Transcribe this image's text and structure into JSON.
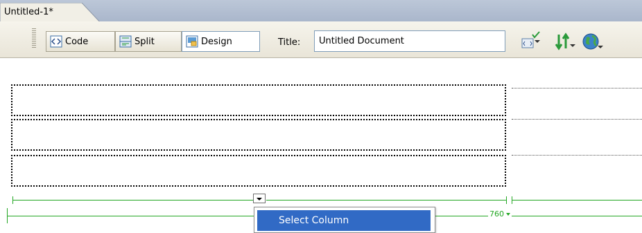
{
  "document": {
    "tab_title": "Untitled-1*"
  },
  "toolbar": {
    "code_label": "Code",
    "split_label": "Split",
    "design_label": "Design",
    "active_view": "Design",
    "title_label": "Title:",
    "title_value": "Untitled Document",
    "icons": [
      "validate-markup-icon",
      "file-management-icon",
      "preview-in-browser-icon"
    ]
  },
  "table": {
    "rows": 3,
    "width_label": "760",
    "column_menu": {
      "items": [
        "Select Column"
      ]
    }
  },
  "colors": {
    "tab_bar": "#a9b6cb",
    "guide_green": "#21a621",
    "menu_highlight": "#316ac5",
    "toolbar_bg": "#efece2"
  }
}
